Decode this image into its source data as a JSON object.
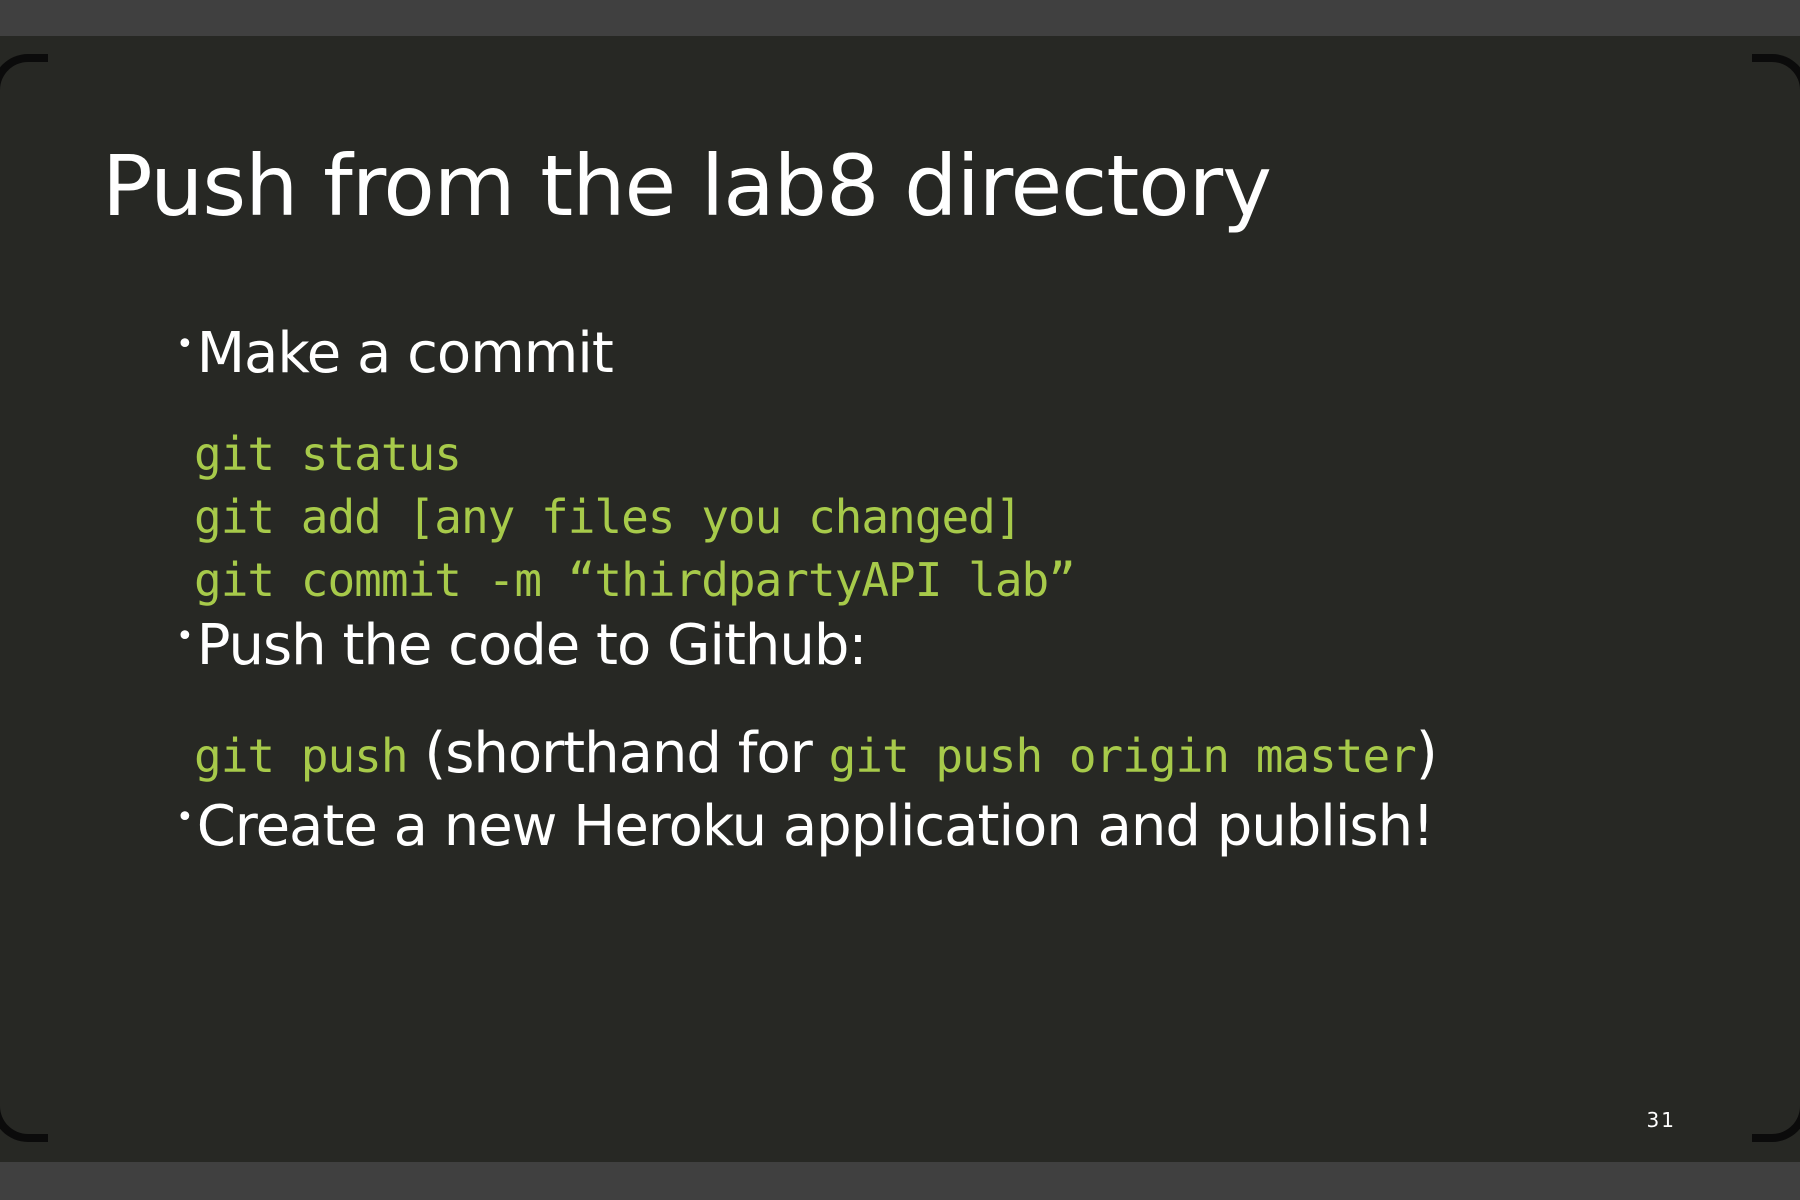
{
  "slide": {
    "title": "Push from the lab8 directory",
    "bullets": [
      {
        "marker": "•",
        "text": "Make a commit"
      },
      {
        "marker": "•",
        "text": "Push the code to Github:"
      },
      {
        "marker": "•",
        "text": "Create a new Heroku application and publish!"
      }
    ],
    "commit_commands": [
      "git status",
      "git add [any files you changed]",
      "git commit -m “thirdpartyAPI lab”"
    ],
    "push_line": {
      "command": "git push",
      "text_before": " (shorthand for ",
      "full_command": "git push origin master",
      "text_after": ")"
    },
    "page_number": "31"
  },
  "colors": {
    "background": "#272824",
    "frame": "#404040",
    "text": "#ffffff",
    "code": "#a7ca4a"
  }
}
